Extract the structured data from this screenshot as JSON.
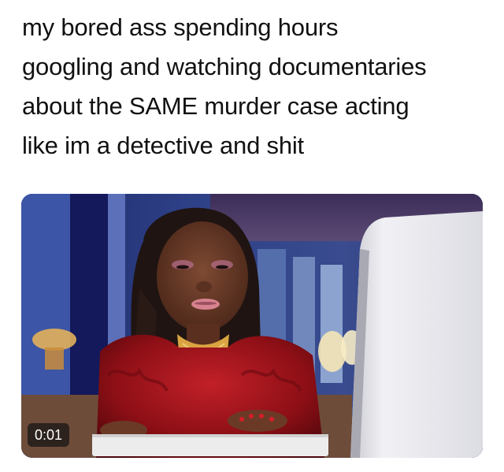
{
  "caption": {
    "lines": [
      "my bored ass spending hours",
      "googling and watching documentaries",
      "about the SAME murder case acting",
      "like im a detective and shit"
    ]
  },
  "video": {
    "timestamp": "0:01"
  },
  "colors": {
    "text": "#111111",
    "background": "#ffffff",
    "timestamp_bg": "#141414",
    "feather_red": "#a3131a",
    "skin": "#6b3a26",
    "monitor": "#e9e9ee",
    "wall_blue": "#2d3f86"
  },
  "icons": {
    "woman": "woman-at-computer-illustration"
  }
}
